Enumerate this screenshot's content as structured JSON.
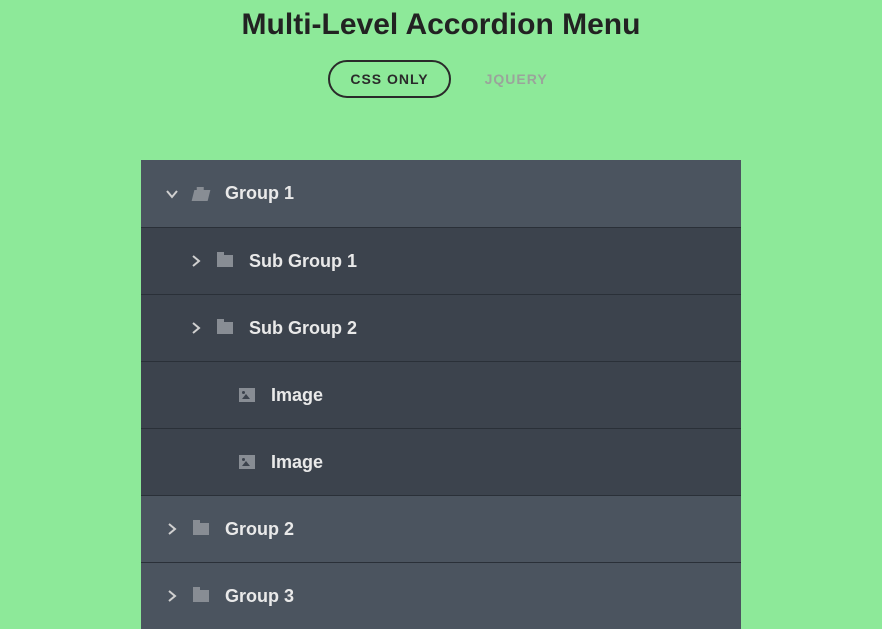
{
  "title": "Multi-Level Accordion Menu",
  "tabs": {
    "css": "CSS ONLY",
    "jquery": "JQUERY"
  },
  "row0": {
    "label": "Group 1"
  },
  "row1": {
    "label": "Sub Group 1"
  },
  "row2": {
    "label": "Sub Group 2"
  },
  "row3": {
    "label": "Image"
  },
  "row4": {
    "label": "Image"
  },
  "row5": {
    "label": "Group 2"
  },
  "row6": {
    "label": "Group 3"
  }
}
